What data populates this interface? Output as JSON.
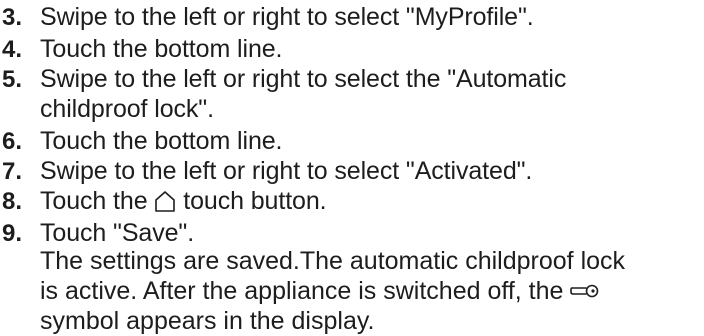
{
  "steps": [
    {
      "number": "3.",
      "text": "Swipe to the left or right to select \"MyProfile\"."
    },
    {
      "number": "4.",
      "text": "Touch the bottom line."
    },
    {
      "number": "5.",
      "line1": "Swipe to the left or right to select the \"Automatic",
      "line2": "childproof lock\"."
    },
    {
      "number": "6.",
      "text": "Touch the bottom line."
    },
    {
      "number": "7.",
      "text": "Swipe to the left or right to select \"Activated\"."
    },
    {
      "number": "8.",
      "before_icon": "Touch the",
      "icon": "home-icon",
      "after_icon": "touch button."
    },
    {
      "number": "9.",
      "text": "Touch \"Save\"."
    }
  ],
  "result": {
    "line1": "The settings are saved.The automatic childproof lock",
    "line2": "is active. After the appliance is switched off, the",
    "symbol_icon": "key-icon",
    "line3": "symbol appears in the display."
  }
}
